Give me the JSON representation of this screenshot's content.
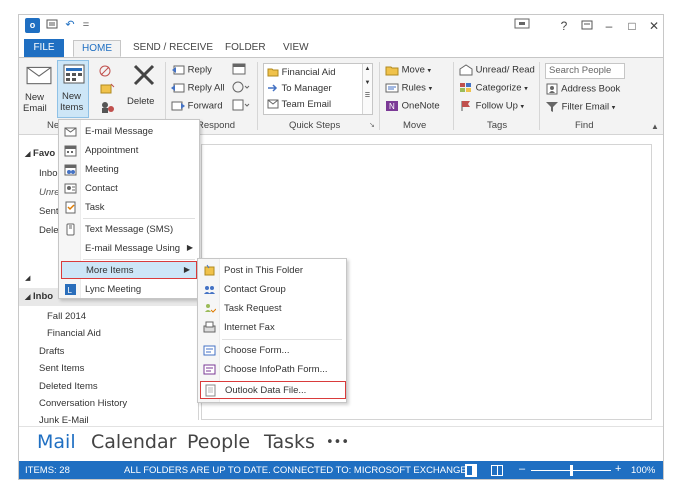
{
  "titlebar": {
    "help": "?",
    "minimize": "–",
    "restore": "□",
    "close": "✕"
  },
  "tabs": [
    {
      "label": "FILE"
    },
    {
      "label": "HOME"
    },
    {
      "label": "SEND / RECEIVE"
    },
    {
      "label": "FOLDER"
    },
    {
      "label": "VIEW"
    }
  ],
  "ribbon": {
    "new_email": [
      "New",
      "Email"
    ],
    "new_items": [
      "New",
      "Items"
    ],
    "delete": "Delete",
    "reply": "Reply",
    "reply_all": "Reply All",
    "forward": "Forward",
    "respond_label": "Respond",
    "new_group_label": "Ne",
    "quick_steps": [
      "Financial Aid",
      "To Manager",
      "Team Email"
    ],
    "quick_steps_label": "Quick Steps",
    "move": "Move",
    "rules": "Rules",
    "onenote": "OneNote",
    "move_label": "Move",
    "unread_read": "Unread/ Read",
    "categorize": "Categorize",
    "follow_up": "Follow Up",
    "tags_label": "Tags",
    "search_placeholder": "Search People",
    "address_book": "Address Book",
    "filter_email": "Filter Email",
    "find_label": "Find"
  },
  "nav": {
    "favorites_partial": "Favo",
    "fav_items": [
      "Inbo",
      "Unre",
      "Sent",
      "Dele"
    ],
    "inbox_partial": "Inbo",
    "folders": [
      "Fall 2014",
      "Financial Aid",
      "Drafts",
      "Sent Items",
      "Deleted Items",
      "Conversation History",
      "Junk E-Mail"
    ]
  },
  "new_items_menu": [
    {
      "label": "E-mail Message",
      "has_sub": false
    },
    {
      "label": "Appointment",
      "has_sub": false
    },
    {
      "label": "Meeting",
      "has_sub": false
    },
    {
      "label": "Contact",
      "has_sub": false
    },
    {
      "label": "Task",
      "has_sub": false
    },
    {
      "label": "Text Message (SMS)",
      "has_sub": false
    },
    {
      "label": "E-mail Message Using",
      "has_sub": true
    },
    {
      "label": "More Items",
      "has_sub": true
    },
    {
      "label": "Lync Meeting",
      "has_sub": false
    }
  ],
  "more_items_menu": [
    {
      "label": "Post in This Folder"
    },
    {
      "label": "Contact Group"
    },
    {
      "label": "Task Request"
    },
    {
      "label": "Internet Fax"
    },
    {
      "label": "Choose Form..."
    },
    {
      "label": "Choose InfoPath Form..."
    },
    {
      "label": "Outlook Data File..."
    }
  ],
  "bottom_nav": [
    "Mail",
    "Calendar",
    "People",
    "Tasks",
    "•••"
  ],
  "status": {
    "items": "ITEMS: 28",
    "folders": "ALL FOLDERS ARE UP TO DATE.",
    "connected": "CONNECTED TO: MICROSOFT EXCHANGE",
    "zoom": "100%",
    "zoom_level": 0.5
  },
  "colors": {
    "accent": "#1f6fc2",
    "highlight_border": "#d93b3b"
  }
}
